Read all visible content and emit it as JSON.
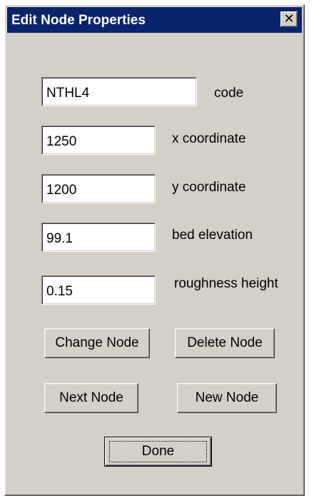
{
  "window": {
    "title": "Edit Node Properties",
    "close_glyph": "✕"
  },
  "fields": {
    "code": {
      "value": "NTHL4",
      "label": "code"
    },
    "x_coordinate": {
      "value": "1250",
      "label": "x coordinate"
    },
    "y_coordinate": {
      "value": "1200",
      "label": "y coordinate"
    },
    "bed_elevation": {
      "value": "99.1",
      "label": "bed elevation"
    },
    "roughness_height": {
      "value": "0.15",
      "label": "roughness height"
    }
  },
  "buttons": {
    "change_node": "Change Node",
    "delete_node": "Delete Node",
    "next_node": "Next Node",
    "new_node": "New Node",
    "done": "Done"
  },
  "colors": {
    "title_bar": "#0a246a",
    "dialog_face": "#d4d0c8"
  }
}
